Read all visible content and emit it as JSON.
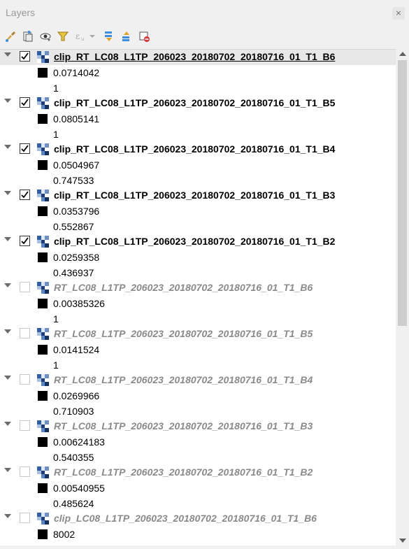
{
  "panel": {
    "title": "Layers",
    "close_glyph": "×"
  },
  "toolbar": {
    "icons": [
      "style-brush-icon",
      "add-group-icon",
      "visibility-eye-icon",
      "filter-funnel-icon",
      "filter-expression-icon",
      "expand-all-icon",
      "collapse-all-icon",
      "remove-layer-icon"
    ]
  },
  "layers": [
    {
      "name": "clip_RT_LC08_L1TP_206023_20180702_20180716_01_T1_B6",
      "checked": true,
      "selected": true,
      "min": "0.0714042",
      "max": "1"
    },
    {
      "name": "clip_RT_LC08_L1TP_206023_20180702_20180716_01_T1_B5",
      "checked": true,
      "selected": false,
      "min": "0.0805141",
      "max": "1"
    },
    {
      "name": "clip_RT_LC08_L1TP_206023_20180702_20180716_01_T1_B4",
      "checked": true,
      "selected": false,
      "min": "0.0504967",
      "max": "0.747533"
    },
    {
      "name": "clip_RT_LC08_L1TP_206023_20180702_20180716_01_T1_B3",
      "checked": true,
      "selected": false,
      "min": "0.0353796",
      "max": "0.552867"
    },
    {
      "name": "clip_RT_LC08_L1TP_206023_20180702_20180716_01_T1_B2",
      "checked": true,
      "selected": false,
      "min": "0.0259358",
      "max": "0.436937"
    },
    {
      "name": "RT_LC08_L1TP_206023_20180702_20180716_01_T1_B6",
      "checked": false,
      "selected": false,
      "min": "0.00385326",
      "max": "1"
    },
    {
      "name": "RT_LC08_L1TP_206023_20180702_20180716_01_T1_B5",
      "checked": false,
      "selected": false,
      "min": "0.0141524",
      "max": "1"
    },
    {
      "name": "RT_LC08_L1TP_206023_20180702_20180716_01_T1_B4",
      "checked": false,
      "selected": false,
      "min": "0.0269966",
      "max": "0.710903"
    },
    {
      "name": "RT_LC08_L1TP_206023_20180702_20180716_01_T1_B3",
      "checked": false,
      "selected": false,
      "min": "0.00624183",
      "max": "0.540355"
    },
    {
      "name": "RT_LC08_L1TP_206023_20180702_20180716_01_T1_B2",
      "checked": false,
      "selected": false,
      "min": "0.00540955",
      "max": "0.485624"
    },
    {
      "name": "clip_LC08_L1TP_206023_20180702_20180716_01_T1_B6",
      "checked": false,
      "selected": false,
      "min": "8002",
      "max": null
    }
  ],
  "colors": {
    "swatch": "#000000",
    "selection": "#e8e8e8",
    "inactive_text": "#8a8a8a"
  }
}
